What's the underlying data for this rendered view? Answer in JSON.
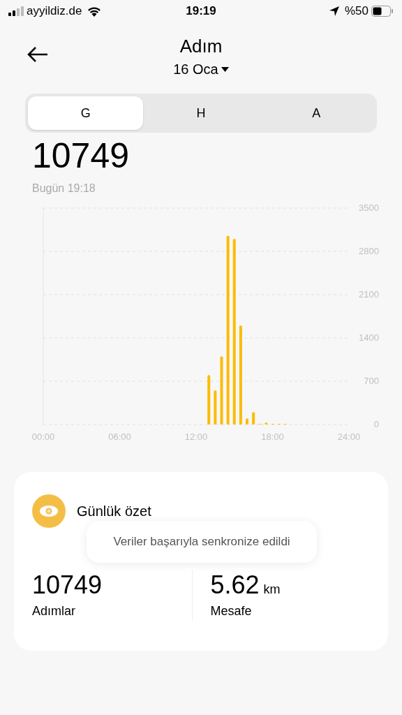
{
  "status_bar": {
    "carrier": "ayyildiz.de",
    "time": "19:19",
    "battery": "%50"
  },
  "header": {
    "title": "Adım",
    "date": "16 Oca"
  },
  "tabs": [
    {
      "label": "G",
      "selected": true
    },
    {
      "label": "H",
      "selected": false
    },
    {
      "label": "A",
      "selected": false
    }
  ],
  "total": "10749",
  "updated": "Bugün 19:18",
  "chart_data": {
    "type": "bar",
    "grid": true,
    "x": [
      13,
      13.5,
      14,
      14.5,
      15,
      15.5,
      16,
      16.5,
      17,
      17.5,
      18,
      18.5,
      19
    ],
    "series": [
      {
        "color": "#fbbc05",
        "values": [
          800,
          550,
          1100,
          3050,
          3000,
          1600,
          100,
          200,
          0,
          30,
          10,
          10,
          10
        ]
      }
    ],
    "xlim": [
      0,
      24
    ],
    "ylim": [
      0,
      3500
    ],
    "xticks": [
      {
        "value": 0,
        "label": "00:00"
      },
      {
        "value": 6,
        "label": "06:00"
      },
      {
        "value": 12,
        "label": "12:00"
      },
      {
        "value": 18,
        "label": "18:00"
      },
      {
        "value": 24,
        "label": "24:00"
      }
    ],
    "yticks": [
      0,
      700,
      1400,
      2100,
      2800,
      3500
    ]
  },
  "summary": {
    "title": "Günlük özet",
    "toast": "Veriler başarıyla senkronize edildi",
    "stats": [
      {
        "value": "10749",
        "label": "Adımlar"
      },
      {
        "value": "5.62",
        "unit": "km",
        "label": "Mesafe"
      }
    ]
  }
}
